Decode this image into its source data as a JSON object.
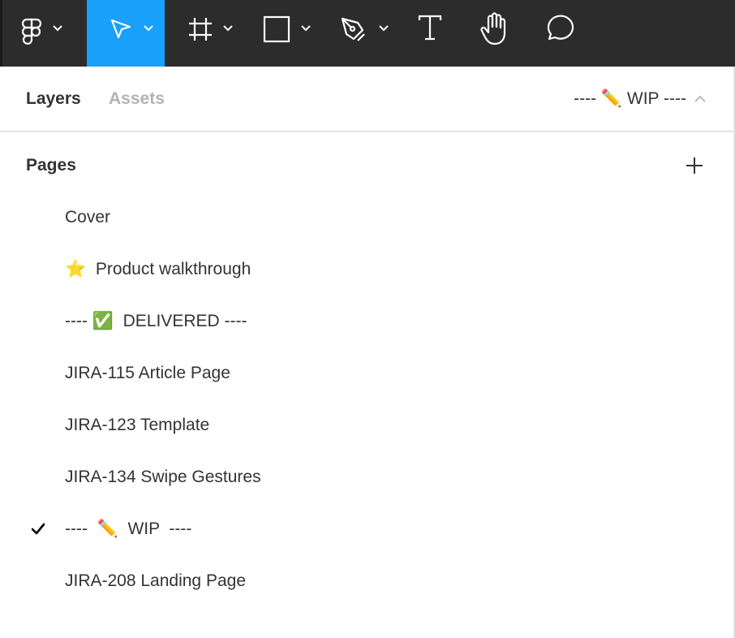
{
  "toolbar": {
    "tools": [
      {
        "name": "main-menu",
        "icon": "figma-logo-icon",
        "has_dropdown": true,
        "active": false
      },
      {
        "name": "move",
        "icon": "cursor-arrow-icon",
        "has_dropdown": true,
        "active": true
      },
      {
        "name": "frame",
        "icon": "frame-icon",
        "has_dropdown": true,
        "active": false
      },
      {
        "name": "shape",
        "icon": "rectangle-icon",
        "has_dropdown": true,
        "active": false
      },
      {
        "name": "pen",
        "icon": "pen-icon",
        "has_dropdown": true,
        "active": false
      },
      {
        "name": "text",
        "icon": "text-icon",
        "has_dropdown": false,
        "active": false
      },
      {
        "name": "hand",
        "icon": "hand-icon",
        "has_dropdown": false,
        "active": false
      },
      {
        "name": "comment",
        "icon": "comment-icon",
        "has_dropdown": false,
        "active": false
      }
    ],
    "colors": {
      "background": "#2c2c2c",
      "active": "#18a0fb",
      "icon": "#ffffff"
    }
  },
  "tabs": {
    "layers": "Layers",
    "assets": "Assets",
    "current_page": "---- ✏️ WIP ----"
  },
  "pages": {
    "title": "Pages",
    "items": [
      {
        "label": "Cover",
        "selected": false
      },
      {
        "label": "⭐  Product walkthrough",
        "selected": false
      },
      {
        "label": "---- ✅  DELIVERED ----",
        "selected": false
      },
      {
        "label": "JIRA-115 Article Page",
        "selected": false
      },
      {
        "label": "JIRA-123 Template",
        "selected": false
      },
      {
        "label": "JIRA-134 Swipe Gestures",
        "selected": false
      },
      {
        "label": "----  ✏️  WIP  ----",
        "selected": true
      },
      {
        "label": "JIRA-208 Landing Page",
        "selected": false
      }
    ]
  }
}
